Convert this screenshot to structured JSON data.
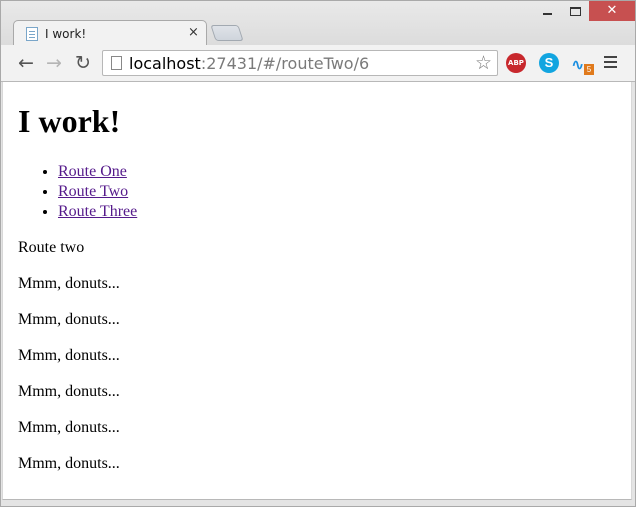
{
  "browser": {
    "tab_title": "I work!",
    "tab_close": "×",
    "url_host": "localhost",
    "url_rest": ":27431/#/routeTwo/6",
    "extensions": {
      "abp_label": "ABP",
      "skype_label": "S",
      "third_badge": "5"
    }
  },
  "page": {
    "heading": "I work!",
    "links": [
      {
        "label": "Route One"
      },
      {
        "label": "Route Two"
      },
      {
        "label": "Route Three"
      }
    ],
    "route_text": "Route two",
    "lines": [
      "Mmm, donuts...",
      "Mmm, donuts...",
      "Mmm, donuts...",
      "Mmm, donuts...",
      "Mmm, donuts...",
      "Mmm, donuts..."
    ]
  }
}
